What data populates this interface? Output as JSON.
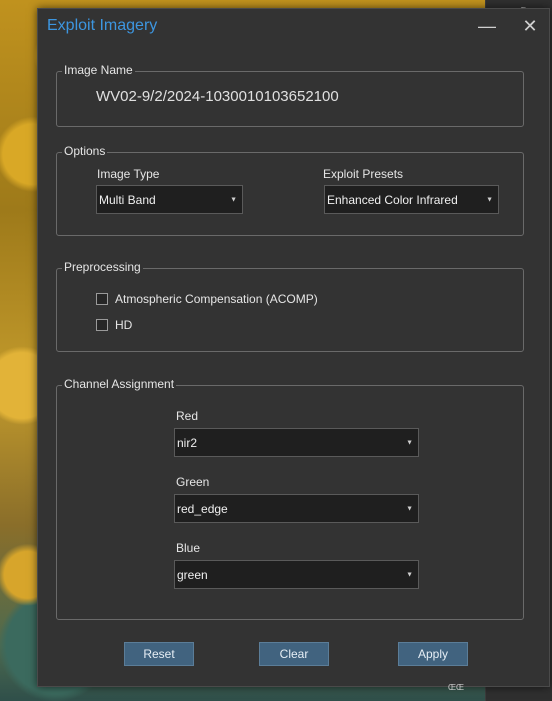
{
  "window": {
    "title": "Exploit Imagery",
    "minimize_glyph": "—",
    "close_glyph": "✕"
  },
  "image_name": {
    "label": "Image Name",
    "value": "WV02-9/2/2024-1030010103652100"
  },
  "options": {
    "label": "Options",
    "image_type": {
      "label": "Image Type",
      "value": "Multi Band"
    },
    "exploit_presets": {
      "label": "Exploit Presets",
      "value": "Enhanced Color Infrared"
    }
  },
  "preprocessing": {
    "label": "Preprocessing",
    "items": [
      {
        "label": "Atmospheric Compensation (ACOMP)",
        "checked": false
      },
      {
        "label": "HD",
        "checked": false
      }
    ]
  },
  "channel_assignment": {
    "label": "Channel Assignment",
    "red": {
      "label": "Red",
      "value": "nir2"
    },
    "green": {
      "label": "Green",
      "value": "red_edge"
    },
    "blue": {
      "label": "Blue",
      "value": "green"
    }
  },
  "buttons": {
    "reset": "Reset",
    "clear": "Clear",
    "apply": "Apply"
  },
  "background": {
    "strip_glyph": "g",
    "logo_text": "ŒŒ"
  },
  "colors": {
    "title": "#3d96e0",
    "button": "#41637f",
    "dialog_bg": "#333333"
  },
  "icons": [
    "minimize-icon",
    "close-icon",
    "dropdown-caret-icon",
    "checkbox-icon"
  ]
}
